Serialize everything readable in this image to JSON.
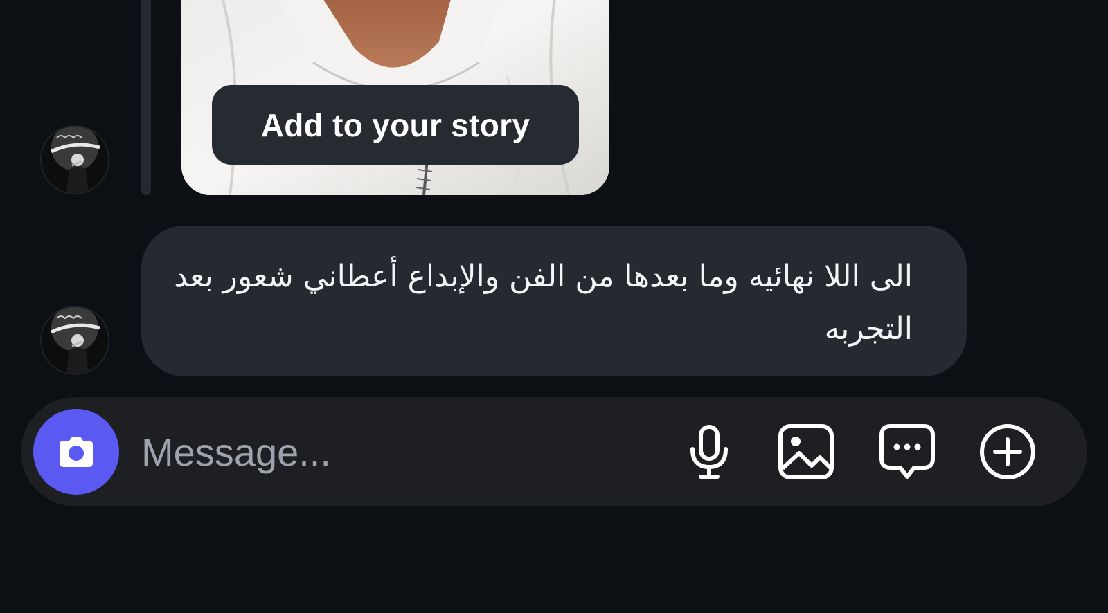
{
  "thread": {
    "story_reply": {
      "add_to_story_label": "Add to your story"
    },
    "message": {
      "text": "الى اللا نهائيه وما بعدها من الفن والإبداع أعطاني شعور بعد التجربه"
    }
  },
  "composer": {
    "placeholder": "Message...",
    "icons": {
      "camera": "camera-icon",
      "microphone": "microphone-icon",
      "gallery": "image-icon",
      "sticker": "chat-bubble-icon",
      "add": "plus-circle-icon"
    }
  },
  "theme": {
    "background": "#0c1014",
    "bubble": "#26292f",
    "composer": "#1d1f23",
    "accent": "#5a5af3",
    "placeholder": "#9da3ad"
  }
}
